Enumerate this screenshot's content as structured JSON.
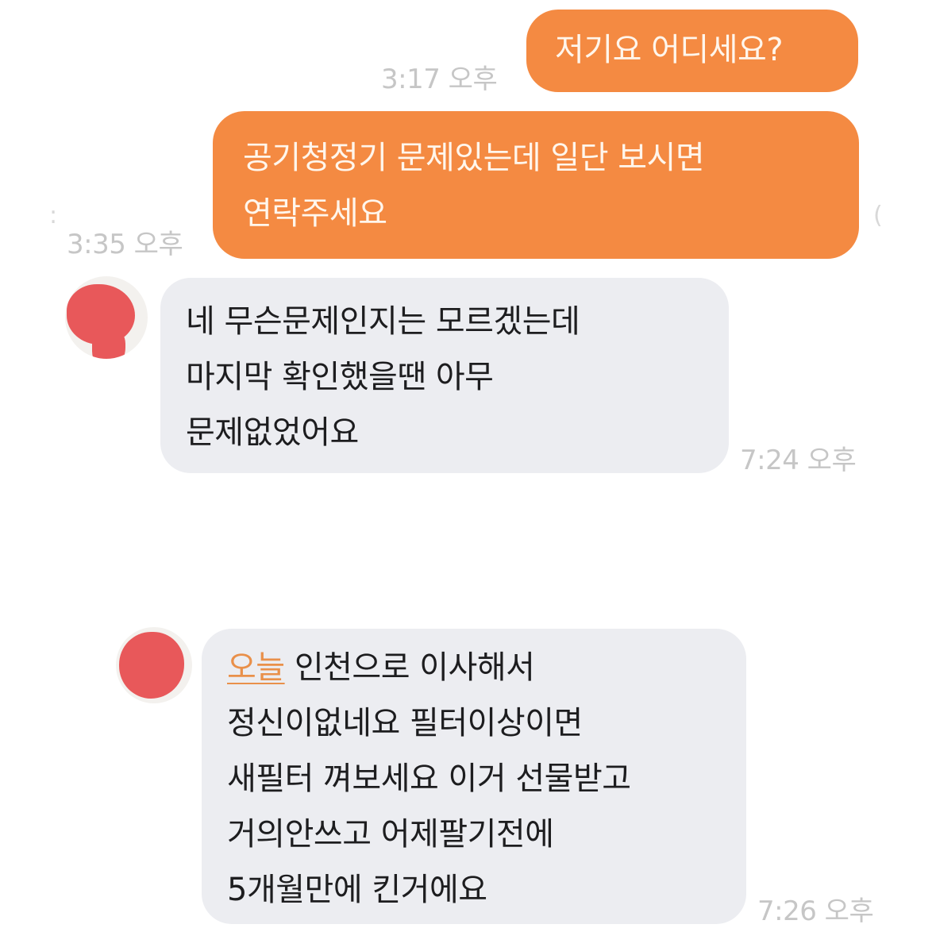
{
  "messages": [
    {
      "id": "m1",
      "sender": "me",
      "lines": [
        "저기요  어디세요?"
      ],
      "time": "3:17 오후"
    },
    {
      "id": "m2",
      "sender": "me",
      "lines": [
        "공기청정기 문제있는데  일단 보시면",
        "연락주세요"
      ],
      "time": "3:35 오후"
    },
    {
      "id": "m3",
      "sender": "other",
      "lines": [
        "네 무슨문제인지는 모르겠는데",
        "마지막 확인했을땐 아무",
        "문제없었어요"
      ],
      "time": "7:24 오후"
    },
    {
      "id": "m4",
      "sender": "other",
      "highlight": "오늘",
      "lines": [
        " 인천으로 이사해서",
        "정신이없네요   필터이상이면",
        "새필터 껴보세요 이거 선물받고",
        "거의안쓰고 어제팔기전에",
        "5개월만에 킨거에요"
      ],
      "time": "7:26 오후"
    }
  ],
  "colors": {
    "my_bubble": "#f48a42",
    "my_text": "#fff6ec",
    "other_bubble": "#ecedf1",
    "other_text": "#1d1d1f",
    "timestamp": "#c6c6c6",
    "avatar_blob": "#e8585a",
    "highlight_link": "#e9904a"
  }
}
